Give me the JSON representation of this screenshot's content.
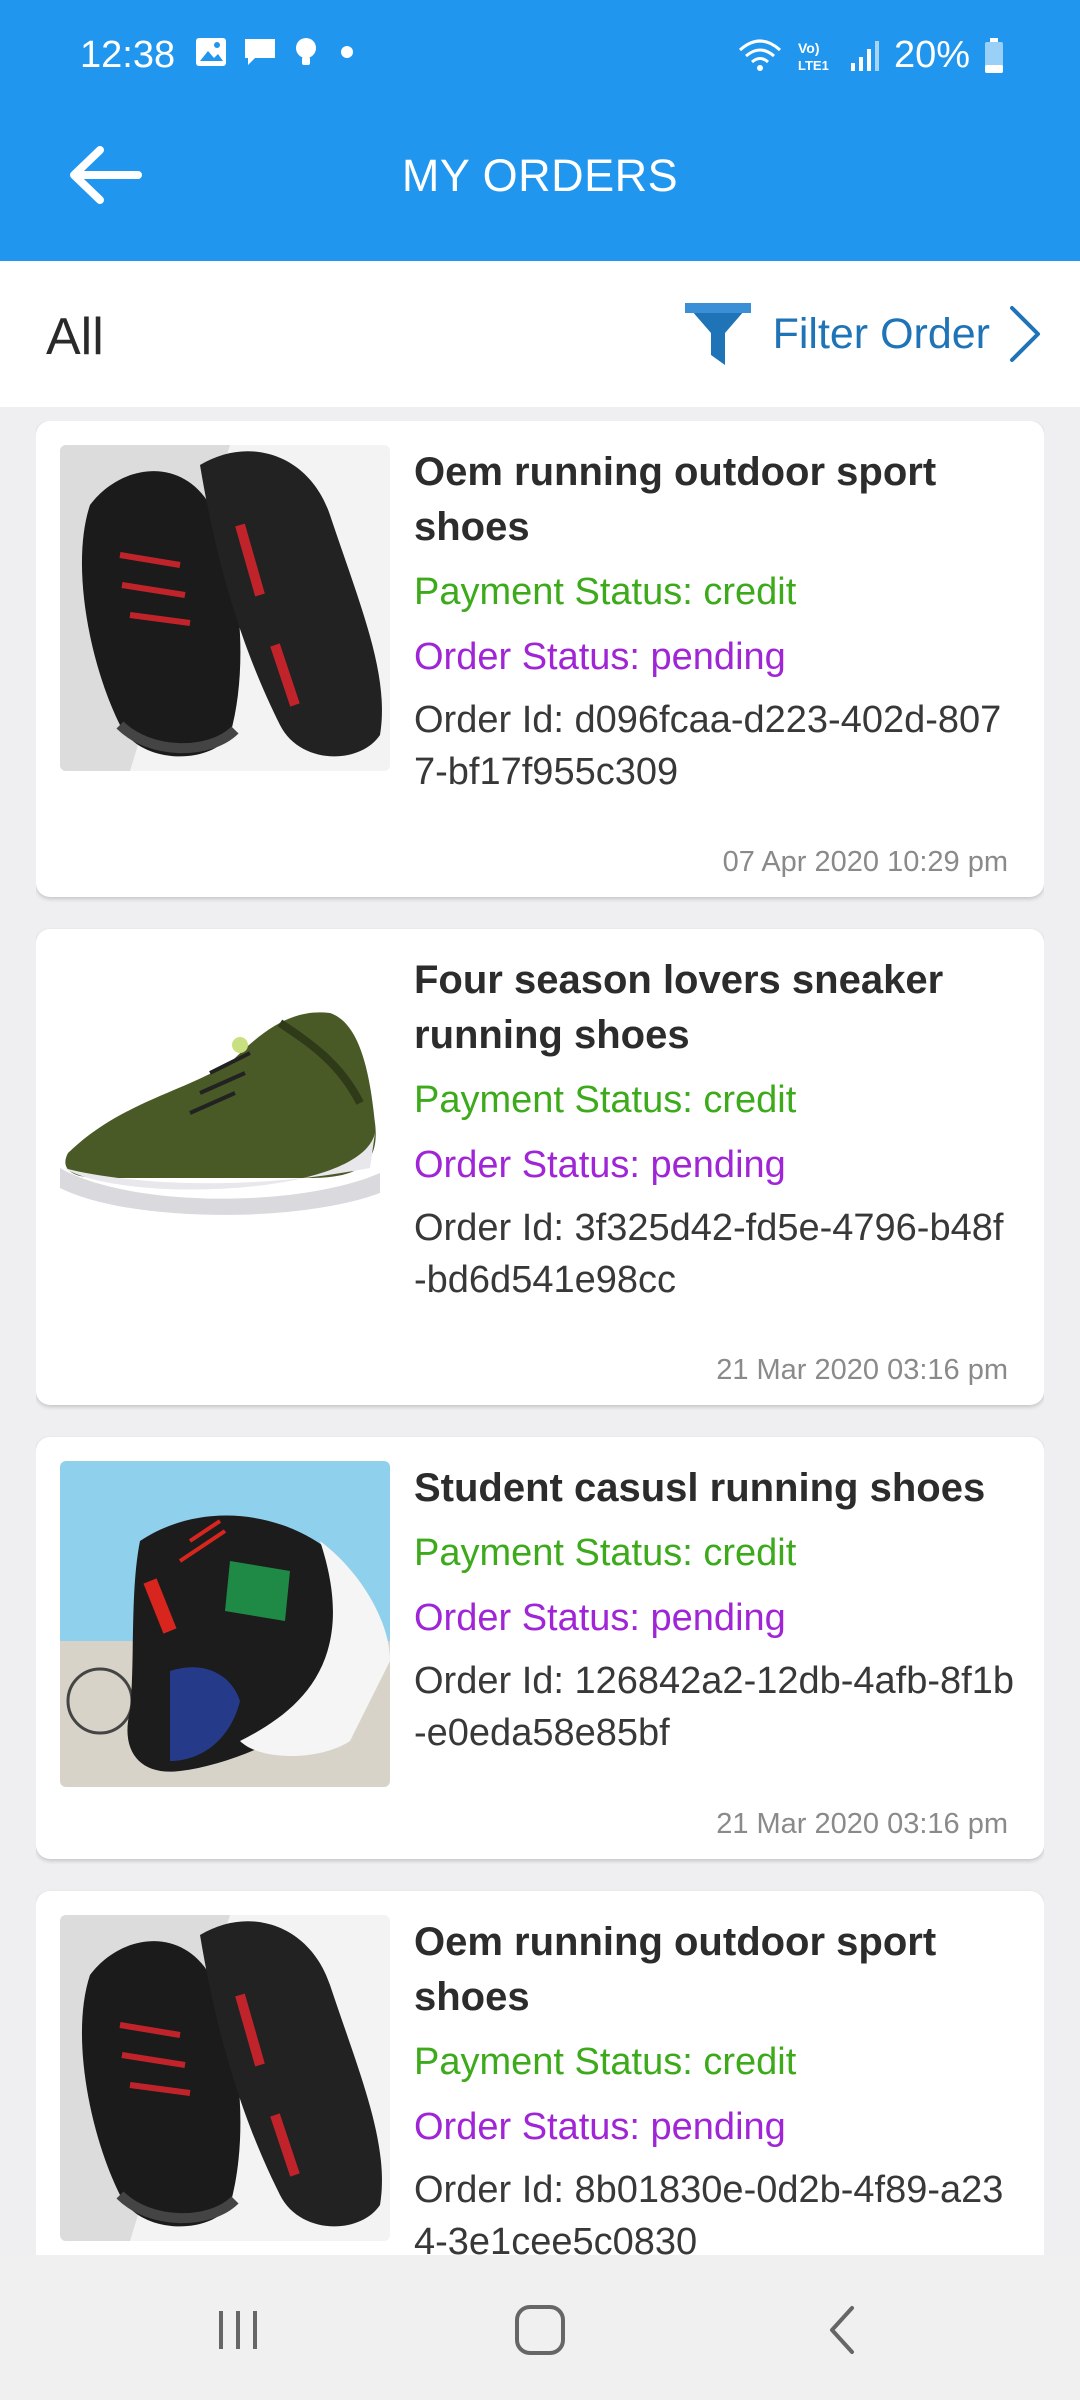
{
  "status_bar": {
    "time": "12:38",
    "icons_left": [
      "image-icon",
      "message-icon",
      "bulb-icon",
      "dot-icon"
    ],
    "icons_right": [
      "wifi-icon",
      "volte-icon",
      "signal-icon",
      "battery-icon"
    ],
    "network_label": "Vo) LTE1",
    "battery": "20%"
  },
  "header": {
    "title": "MY ORDERS",
    "back_icon": "arrow-left-icon"
  },
  "filter": {
    "current": "All",
    "label": "Filter Order",
    "icon": "funnel-icon",
    "chevron": "chevron-right-icon"
  },
  "colors": {
    "app_bar": "#2196ef",
    "payment_status": "#3daa1b",
    "order_status": "#a025d6",
    "filter_link": "#1f73b7"
  },
  "orders": [
    {
      "name": "Oem running outdoor sport shoes",
      "payment": "Payment Status: credit",
      "status": "Order Status: pending",
      "order_id": "Order Id: d096fcaa-d223-402d-8077-bf17f955c309",
      "date": "07 Apr 2020 10:29 pm",
      "image": "black-sneakers-pair"
    },
    {
      "name": "Four season lovers sneaker running shoes",
      "payment": "Payment Status: credit",
      "status": "Order Status: pending",
      "order_id": "Order Id: 3f325d42-fd5e-4796-b48f-bd6d541e98cc",
      "date": "21 Mar 2020 03:16 pm",
      "image": "green-sneaker"
    },
    {
      "name": "Student casusl running shoes",
      "payment": "Payment Status: credit",
      "status": "Order Status: pending",
      "order_id": "Order Id: 126842a2-12db-4afb-8f1b-e0eda58e85bf",
      "date": "21 Mar 2020 03:16 pm",
      "image": "colorful-sneaker"
    },
    {
      "name": "Oem running outdoor sport shoes",
      "payment": "Payment Status: credit",
      "status": "Order Status: pending",
      "order_id": "Order Id: 8b01830e-0d2b-4f89-a234-3e1cee5c0830",
      "date": "",
      "image": "black-sneakers-pair"
    }
  ],
  "nav": {
    "recents": "recents-icon",
    "home": "home-icon",
    "back": "back-icon"
  }
}
